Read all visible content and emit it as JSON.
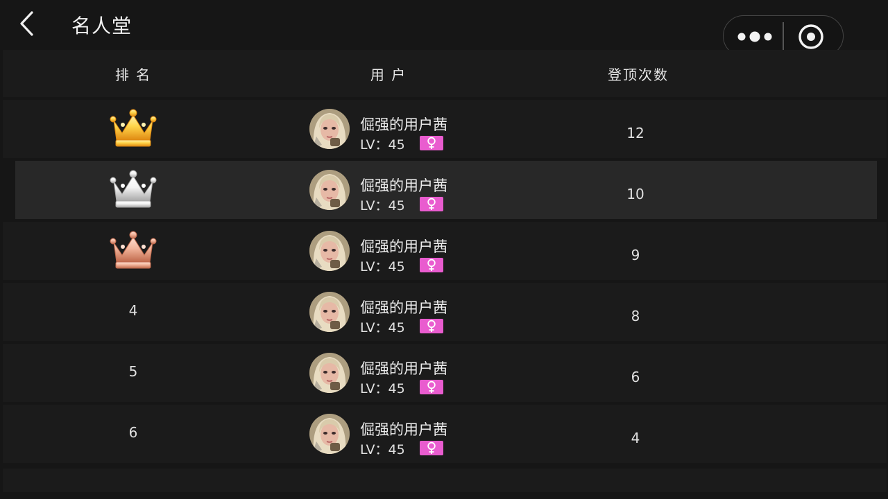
{
  "header": {
    "title": "名人堂",
    "back_icon": "chevron-left-icon"
  },
  "capsule": {
    "menu_icon": "more-dots-icon",
    "close_icon": "target-circle-icon"
  },
  "table": {
    "headers": [
      "排 名",
      "用 户",
      "登顶次数"
    ],
    "rows": [
      {
        "rank": "1",
        "rank_icon": "gold-crown-icon",
        "username": "倔强的用户茜",
        "level": "LV：45",
        "gender_icon": "female-icon",
        "count": "12"
      },
      {
        "rank": "2",
        "rank_icon": "silver-crown-icon",
        "username": "倔强的用户茜",
        "level": "LV：45",
        "gender_icon": "female-icon",
        "count": "10"
      },
      {
        "rank": "3",
        "rank_icon": "bronze-crown-icon",
        "username": "倔强的用户茜",
        "level": "LV：45",
        "gender_icon": "female-icon",
        "count": "9"
      },
      {
        "rank": "4",
        "rank_icon": "",
        "username": "倔强的用户茜",
        "level": "LV：45",
        "gender_icon": "female-icon",
        "count": "8"
      },
      {
        "rank": "5",
        "rank_icon": "",
        "username": "倔强的用户茜",
        "level": "LV：45",
        "gender_icon": "female-icon",
        "count": "6"
      },
      {
        "rank": "6",
        "rank_icon": "",
        "username": "倔强的用户茜",
        "level": "LV：45",
        "gender_icon": "female-icon",
        "count": "4"
      }
    ]
  },
  "colors": {
    "background": "#161616",
    "row": "#1b1b1b",
    "row_highlight": "#282828",
    "gender_badge": "#e95ccf",
    "gold": "#f4b21c",
    "silver": "#d8d8d8",
    "bronze": "#e0957a"
  }
}
